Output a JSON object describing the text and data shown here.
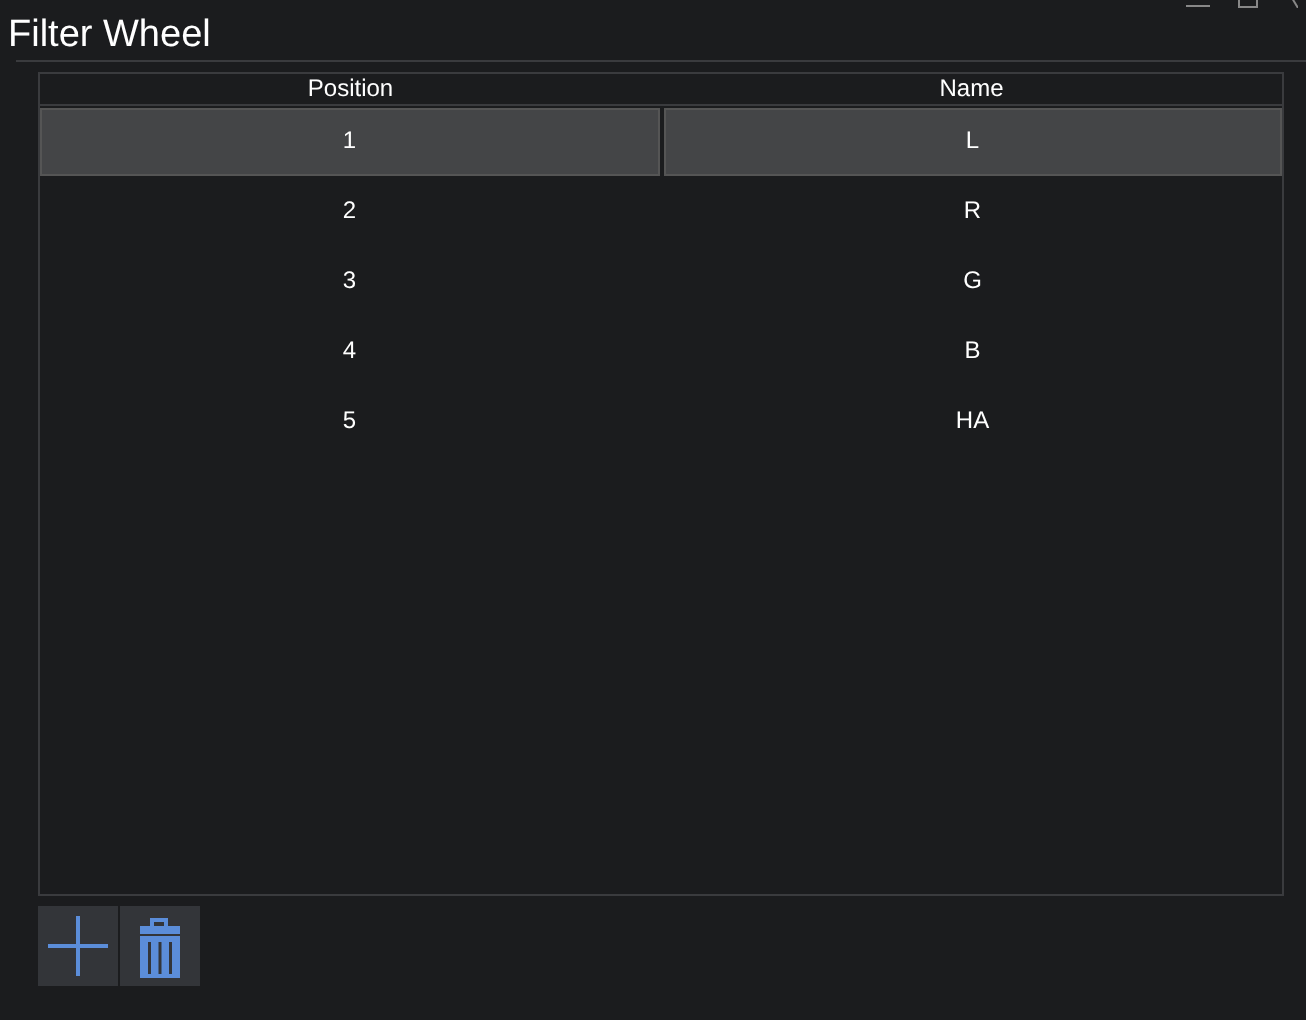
{
  "window": {
    "title": "Filter Wheel"
  },
  "table": {
    "columns": [
      "Position",
      "Name"
    ],
    "rows": [
      {
        "cells": [
          "1",
          "L"
        ],
        "selected": true
      },
      {
        "cells": [
          "2",
          "R"
        ],
        "selected": false
      },
      {
        "cells": [
          "3",
          "G"
        ],
        "selected": false
      },
      {
        "cells": [
          "4",
          "B"
        ],
        "selected": false
      },
      {
        "cells": [
          "5",
          "HA"
        ],
        "selected": false
      }
    ]
  }
}
